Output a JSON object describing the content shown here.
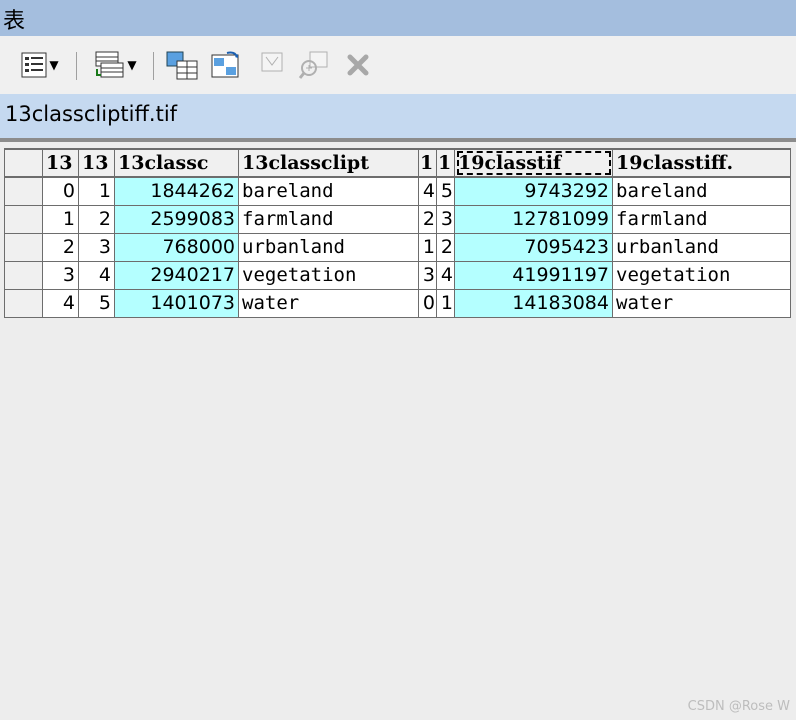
{
  "window": {
    "title": "表"
  },
  "toolbar": {
    "buttons": [
      {
        "name": "table-options-icon"
      },
      {
        "name": "related-tables-icon"
      },
      {
        "name": "select-by-attributes-icon"
      },
      {
        "name": "switch-selection-icon"
      },
      {
        "name": "clear-selection-icon"
      },
      {
        "name": "zoom-to-selected-icon"
      },
      {
        "name": "delete-selected-icon"
      }
    ]
  },
  "tab": {
    "name": "13classcliptiff.tif"
  },
  "table": {
    "headers": [
      "13",
      "13",
      "13classc",
      "13classclipt",
      "1",
      "1",
      "19classtif",
      "19classtiff."
    ],
    "rows": [
      [
        "0",
        "1",
        "1844262",
        "bareland",
        "4",
        "5",
        "9743292",
        "bareland"
      ],
      [
        "1",
        "2",
        "2599083",
        "farmland",
        "2",
        "3",
        "12781099",
        "farmland"
      ],
      [
        "2",
        "3",
        "768000",
        "urbanland",
        "1",
        "2",
        "7095423",
        "urbanland"
      ],
      [
        "3",
        "4",
        "2940217",
        "vegetation",
        "3",
        "4",
        "41991197",
        "vegetation"
      ],
      [
        "4",
        "5",
        "1401073",
        "water",
        "0",
        "1",
        "14183084",
        "water"
      ]
    ]
  },
  "watermark": "CSDN @Rose W"
}
